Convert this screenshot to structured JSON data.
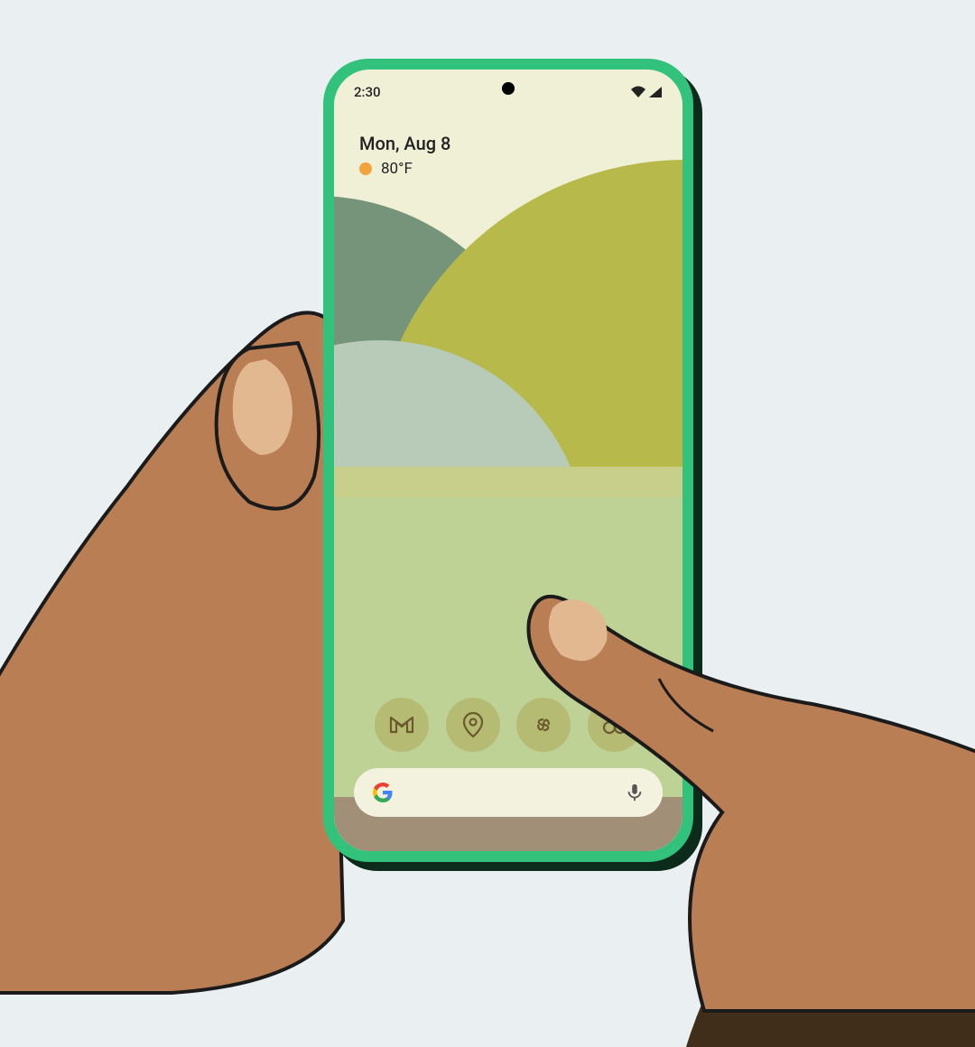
{
  "status": {
    "time": "2:30"
  },
  "widget": {
    "date": "Mon, Aug 8",
    "temperature": "80°F"
  },
  "dock": {
    "apps": [
      {
        "name": "gmail"
      },
      {
        "name": "maps"
      },
      {
        "name": "photos"
      },
      {
        "name": "lookout"
      }
    ]
  },
  "search": {
    "provider": "Google"
  },
  "colors": {
    "bezel": "#32c27c",
    "iconTint": "#6b5a2e",
    "iconBg": "#b5bb73",
    "sun": "#f2a33c"
  }
}
